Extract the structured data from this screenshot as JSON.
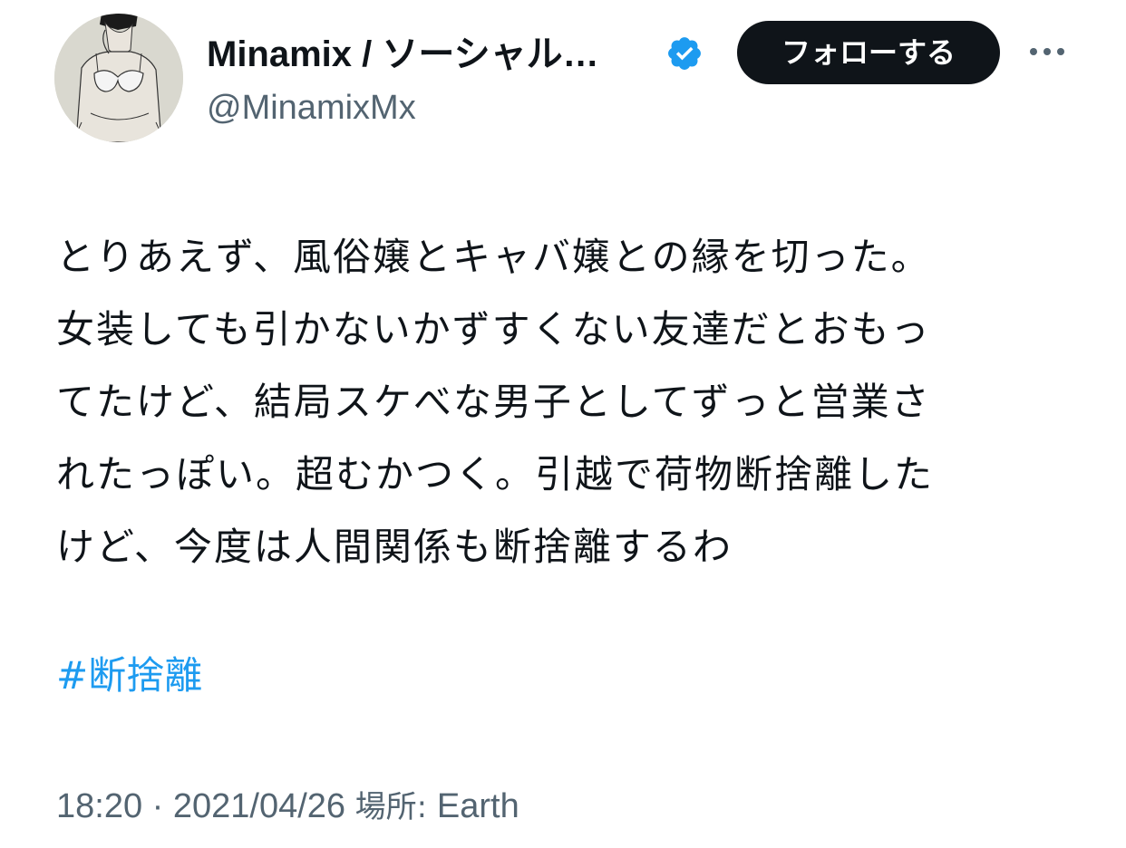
{
  "author": {
    "display_name": "Minamix / ソーシャル…",
    "handle": "@MinamixMx",
    "verified": true,
    "avatar_icon": "illustrated-figure-avatar"
  },
  "actions": {
    "follow_label": "フォローする",
    "more_icon": "more-horizontal-icon"
  },
  "tweet": {
    "lines": [
      "とりあえず、風俗嬢とキャバ嬢との縁を切った。",
      "女装しても引かないかずすくない友達だとおもっ",
      "てたけど、結局スケべな男子としてずっと営業さ",
      "れたっぽい。超むかつく。引越で荷物断捨離した",
      "けど、今度は人間関係も断捨離するわ"
    ],
    "hashtag": "#断捨離"
  },
  "meta": {
    "time": "18:20",
    "separator": "·",
    "date": "2021/04/26",
    "place_label": "場所: ",
    "place": "Earth"
  },
  "colors": {
    "text": "#0f1419",
    "secondary": "#536471",
    "link": "#1d9bf0",
    "button_bg": "#0f1419",
    "verified": "#1d9bf0"
  }
}
